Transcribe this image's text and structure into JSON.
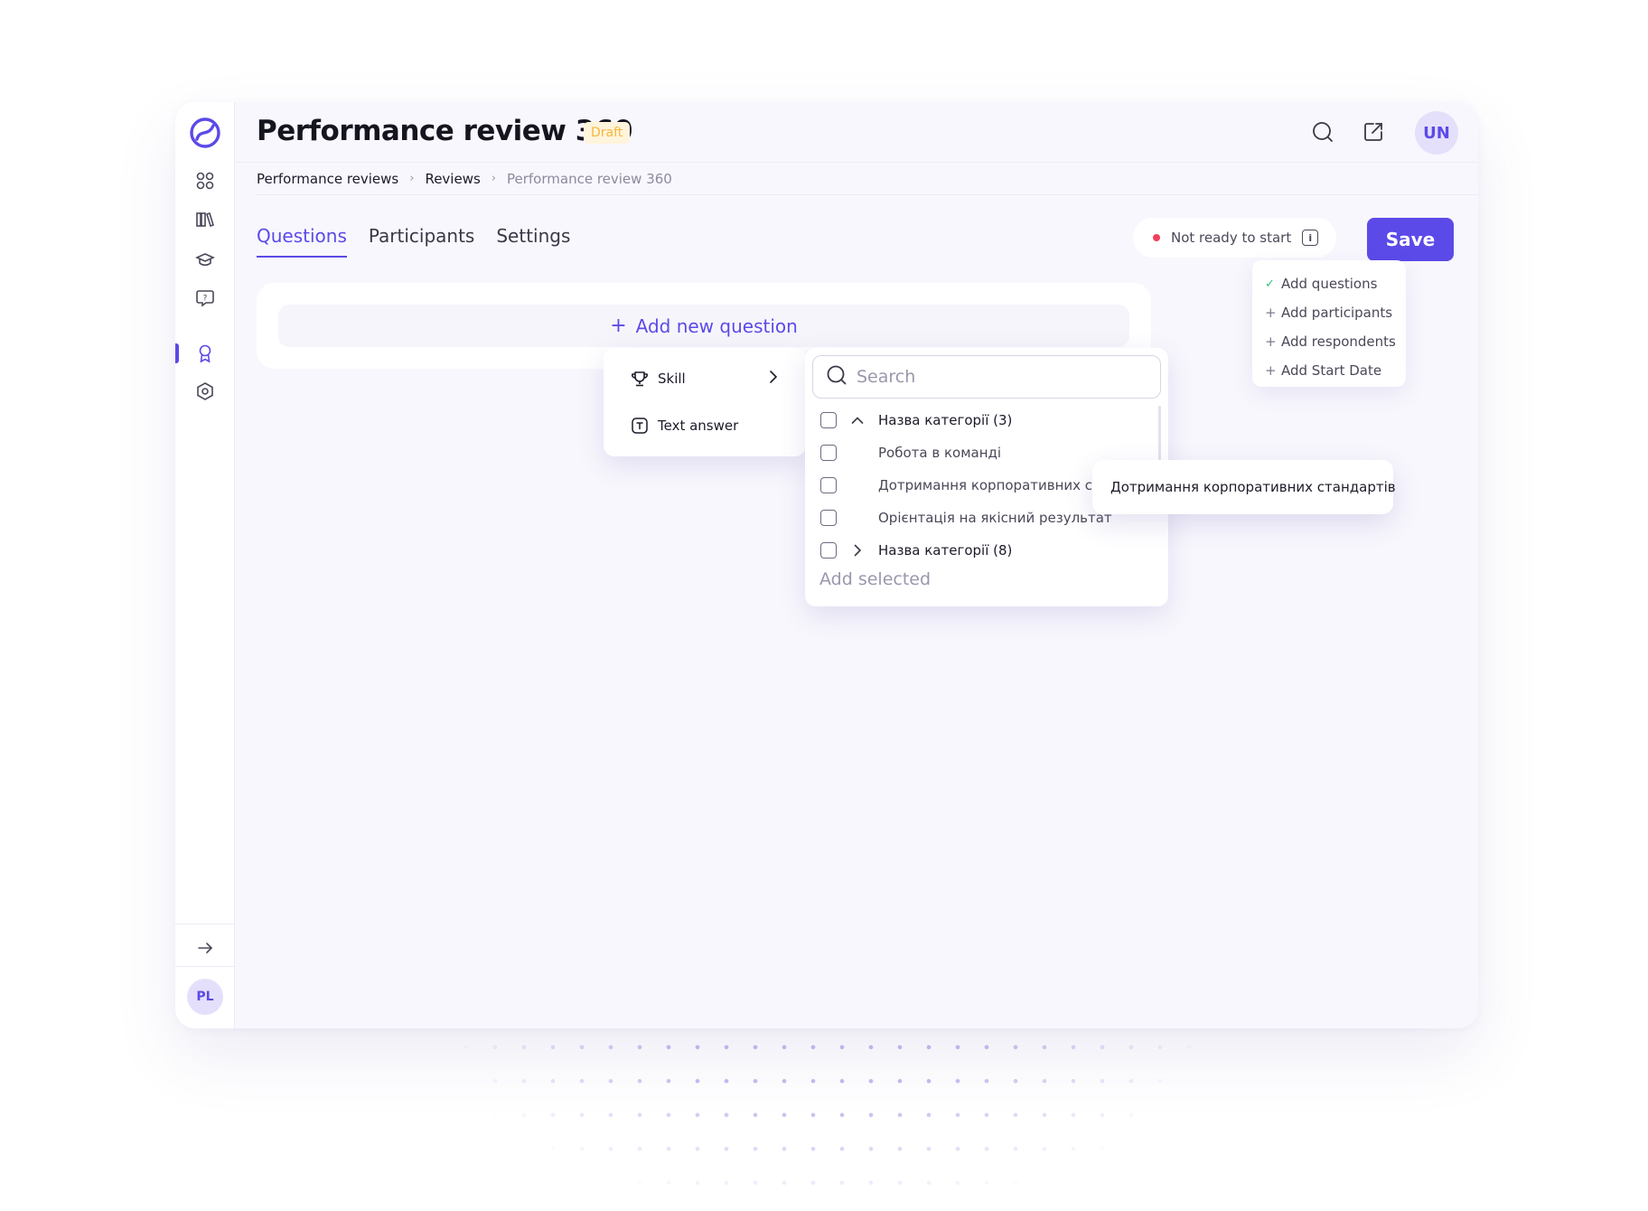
{
  "app": {
    "title": "Performance review 360",
    "status_badge": "Draft",
    "user_initials": "UN",
    "sidebar_user_initials": "PL"
  },
  "sidebar": {
    "items": [
      {
        "icon": "apps-grid-icon"
      },
      {
        "icon": "library-icon"
      },
      {
        "icon": "graduation-cap-icon"
      },
      {
        "icon": "help-chat-icon"
      },
      {
        "icon": "award-icon",
        "active": true
      },
      {
        "icon": "settings-hex-icon"
      }
    ],
    "collapse_icon": "arrow-right-icon"
  },
  "header": {
    "icons": [
      "search-icon",
      "external-link-icon"
    ]
  },
  "breadcrumb": {
    "items": [
      "Performance reviews",
      "Reviews",
      "Performance review 360"
    ]
  },
  "tabs": [
    {
      "label": "Questions",
      "active": true
    },
    {
      "label": "Participants"
    },
    {
      "label": "Settings"
    }
  ],
  "readiness": {
    "label": "Not ready to start",
    "dot_color": "#f0405c",
    "checklist": [
      {
        "label": "Add questions",
        "done": true
      },
      {
        "label": "Add participants",
        "done": false
      },
      {
        "label": "Add respondents",
        "done": false
      },
      {
        "label": "Add Start Date",
        "done": false
      }
    ]
  },
  "save_label": "Save",
  "add_question_label": "Add new question",
  "question_types": [
    {
      "label": "Skill",
      "icon": "trophy-icon",
      "has_submenu": true
    },
    {
      "label": "Text answer",
      "icon": "text-box-icon"
    }
  ],
  "skill_picker": {
    "search_placeholder": "Search",
    "rows": [
      {
        "label": "Назва категорії (3)",
        "kind": "category",
        "expanded": true
      },
      {
        "label": "Робота в команді",
        "kind": "item"
      },
      {
        "label": "Дотримання корпоративних стандартів",
        "kind": "item"
      },
      {
        "label": "Орієнтація на якісний результат",
        "kind": "item"
      },
      {
        "label": "Назва категорії (8)",
        "kind": "category",
        "expanded": false
      }
    ],
    "add_selected_label": "Add selected"
  },
  "tooltip_text": "Дотримання корпоративних стандартів",
  "colors": {
    "accent": "#5b4ae8",
    "success": "#31c27b",
    "draft": "#f5b73b"
  }
}
